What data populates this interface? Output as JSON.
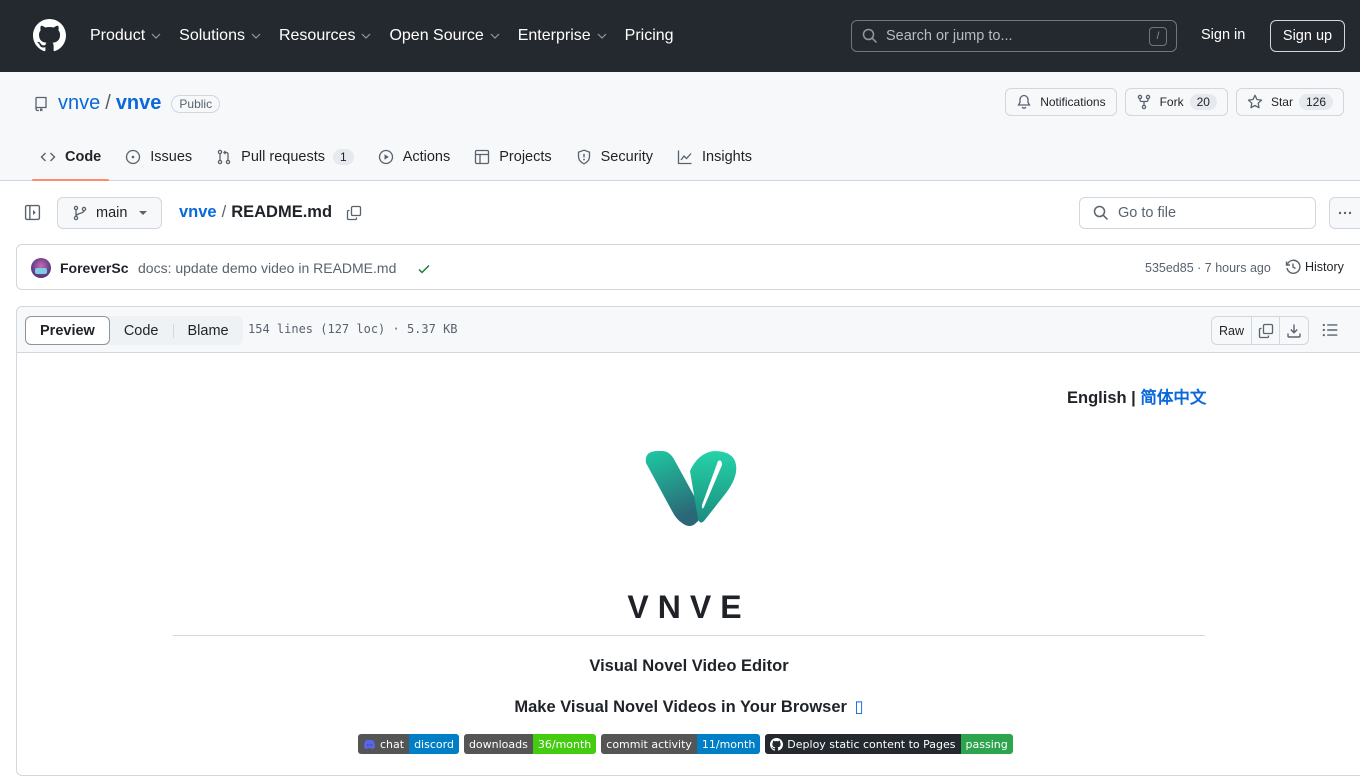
{
  "topbar": {
    "nav": [
      {
        "label": "Product",
        "dropdown": true
      },
      {
        "label": "Solutions",
        "dropdown": true
      },
      {
        "label": "Resources",
        "dropdown": true
      },
      {
        "label": "Open Source",
        "dropdown": true
      },
      {
        "label": "Enterprise",
        "dropdown": true
      },
      {
        "label": "Pricing",
        "dropdown": false
      }
    ],
    "search_placeholder": "Search or jump to...",
    "search_shortcut": "/",
    "sign_in": "Sign in",
    "sign_up": "Sign up"
  },
  "repo": {
    "owner": "vnve",
    "separator": "/",
    "name": "vnve",
    "visibility": "Public",
    "notifications_label": "Notifications",
    "fork_label": "Fork",
    "fork_count": "20",
    "star_label": "Star",
    "star_count": "126"
  },
  "tabs": [
    {
      "label": "Code",
      "icon": "code-icon",
      "active": true
    },
    {
      "label": "Issues",
      "icon": "issue-icon"
    },
    {
      "label": "Pull requests",
      "icon": "pull-request-icon",
      "count": "1"
    },
    {
      "label": "Actions",
      "icon": "play-icon"
    },
    {
      "label": "Projects",
      "icon": "table-icon"
    },
    {
      "label": "Security",
      "icon": "shield-icon"
    },
    {
      "label": "Insights",
      "icon": "graph-icon"
    }
  ],
  "file_nav": {
    "branch": "main",
    "crumb_owner": "vnve",
    "crumb_sep": "/",
    "file_name": "README.md",
    "goto_placeholder": "Go to file"
  },
  "commit": {
    "author": "ForeverSc",
    "message": "docs: update demo video in README.md",
    "status": "success",
    "sha_time": "535ed85 · 7 hours ago",
    "history": "History"
  },
  "file_header": {
    "views": [
      "Preview",
      "Code",
      "Blame"
    ],
    "active_view": "Preview",
    "info": "154 lines (127 loc) · 5.37 KB",
    "raw": "Raw"
  },
  "readme": {
    "lang_en": "English |",
    "lang_zh": "简体中文",
    "title": "VNVE",
    "subtitle": "Visual Novel Video Editor",
    "tagline": "Make Visual Novel Videos in Your Browser",
    "tagline_link": "▯",
    "badges": [
      {
        "left": "chat",
        "right": "discord",
        "color": "#007ec6",
        "icon": "discord-icon"
      },
      {
        "left": "downloads",
        "right": "36/month",
        "color": "#4c1"
      },
      {
        "left": "commit activity",
        "right": "11/month",
        "color": "#007ec6"
      },
      {
        "left": "Deploy static content to Pages",
        "right": "passing",
        "color": "#2ea44f",
        "icon": "github-icon",
        "dark": true
      }
    ]
  }
}
